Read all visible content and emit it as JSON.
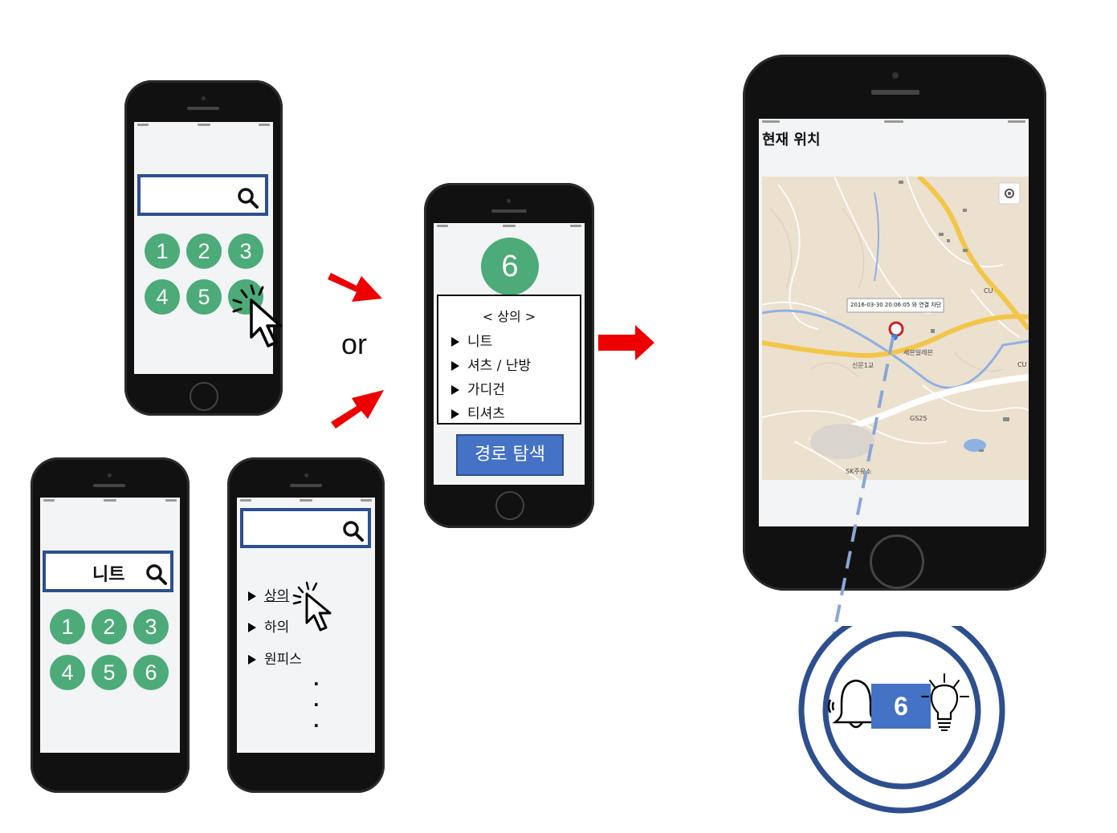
{
  "phone1": {
    "keys": [
      "1",
      "2",
      "3",
      "4",
      "5"
    ]
  },
  "phone2": {
    "search_value": "니트",
    "keys": [
      "1",
      "2",
      "3",
      "4",
      "5",
      "6"
    ]
  },
  "phone3": {
    "menu": [
      "상의",
      "하의",
      "원피스"
    ],
    "dots": [
      "·",
      "·",
      "·"
    ]
  },
  "connector": {
    "or_label": "or"
  },
  "phone4": {
    "number": "6",
    "category_header": "< 상의 >",
    "items": [
      "니트",
      "셔츠 / 난방",
      "가디건",
      "티셔츠"
    ],
    "route_button": "경로 탐색"
  },
  "phone5": {
    "title": "현재 위치",
    "map": {
      "popup": "2016-03-30 20:06:05 와 연결 차단",
      "labels": {
        "store": "세븐일레븐",
        "intersection": "신문1교",
        "gs": "GS25",
        "sk": "SK주유소",
        "cu1": "CU",
        "cu2": "CU"
      }
    }
  },
  "device": {
    "number": "6"
  },
  "colors": {
    "green": "#4cab78",
    "navy": "#2e4f8f",
    "blue_button": "#4472c4",
    "red_arrow": "#ee0000"
  }
}
